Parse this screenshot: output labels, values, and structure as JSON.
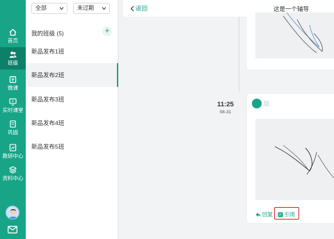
{
  "nav": {
    "items": [
      {
        "label": "首页",
        "icon": "home-icon"
      },
      {
        "label": "班级",
        "icon": "users-icon"
      },
      {
        "label": "微课",
        "icon": "micro-lesson-icon"
      },
      {
        "label": "实时课堂",
        "icon": "live-class-icon"
      },
      {
        "label": "巩固",
        "icon": "consolidate-icon"
      },
      {
        "label": "教研中心",
        "icon": "research-icon"
      },
      {
        "label": "资料中心",
        "icon": "materials-icon"
      }
    ],
    "active": "班级",
    "accent": "#17a487"
  },
  "filters": {
    "scope": "全部",
    "status": "未过期"
  },
  "classes": {
    "heading": "我的班级 (5)",
    "items": [
      "新品发布1班",
      "新品发布2班",
      "新品发布3班",
      "新品发布4班",
      "新品发布5班"
    ],
    "selected": "新品发布2班"
  },
  "header": {
    "back": "返回",
    "title": "这是一个辅导"
  },
  "thread": {
    "time": "11:25",
    "date": "08-31",
    "reply_label": "回复",
    "cite_label": "引用"
  }
}
